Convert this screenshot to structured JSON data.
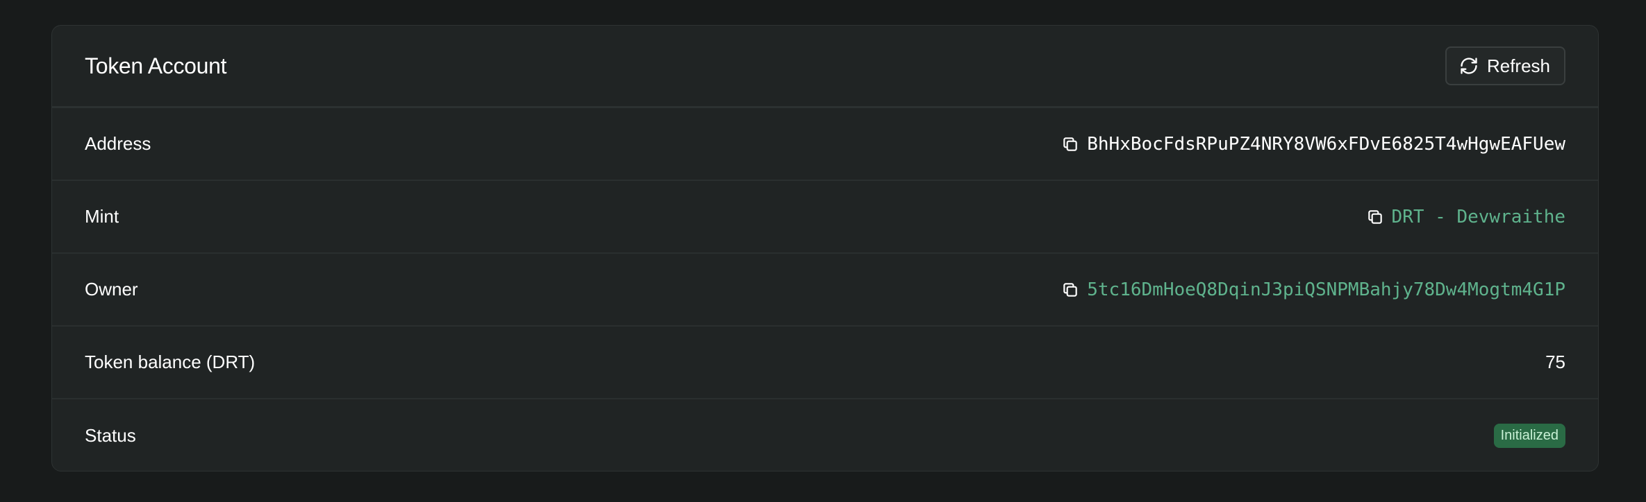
{
  "card": {
    "title": "Token Account",
    "refresh_label": "Refresh"
  },
  "rows": [
    {
      "label": "Address",
      "value": "BhHxBocFdsRPuPZ4NRY8VW6xFDvE6825T4wHgwEAFUew"
    },
    {
      "label": "Mint",
      "value": "DRT - Devwraithe"
    },
    {
      "label": "Owner",
      "value": "5tc16DmHoeQ8DqinJ3piQSNPMBahjy78Dw4Mogtm4G1P"
    },
    {
      "label": "Token balance (DRT)",
      "value": "75"
    },
    {
      "label": "Status",
      "value": "Initialized"
    }
  ],
  "icons": {
    "refresh": "refresh-icon",
    "copy": "copy-icon"
  },
  "colors": {
    "background": "#181b1b",
    "card": "#202424",
    "link": "#5fb38d",
    "badge_bg": "#2a6b45",
    "badge_text": "#c9f1d6"
  }
}
